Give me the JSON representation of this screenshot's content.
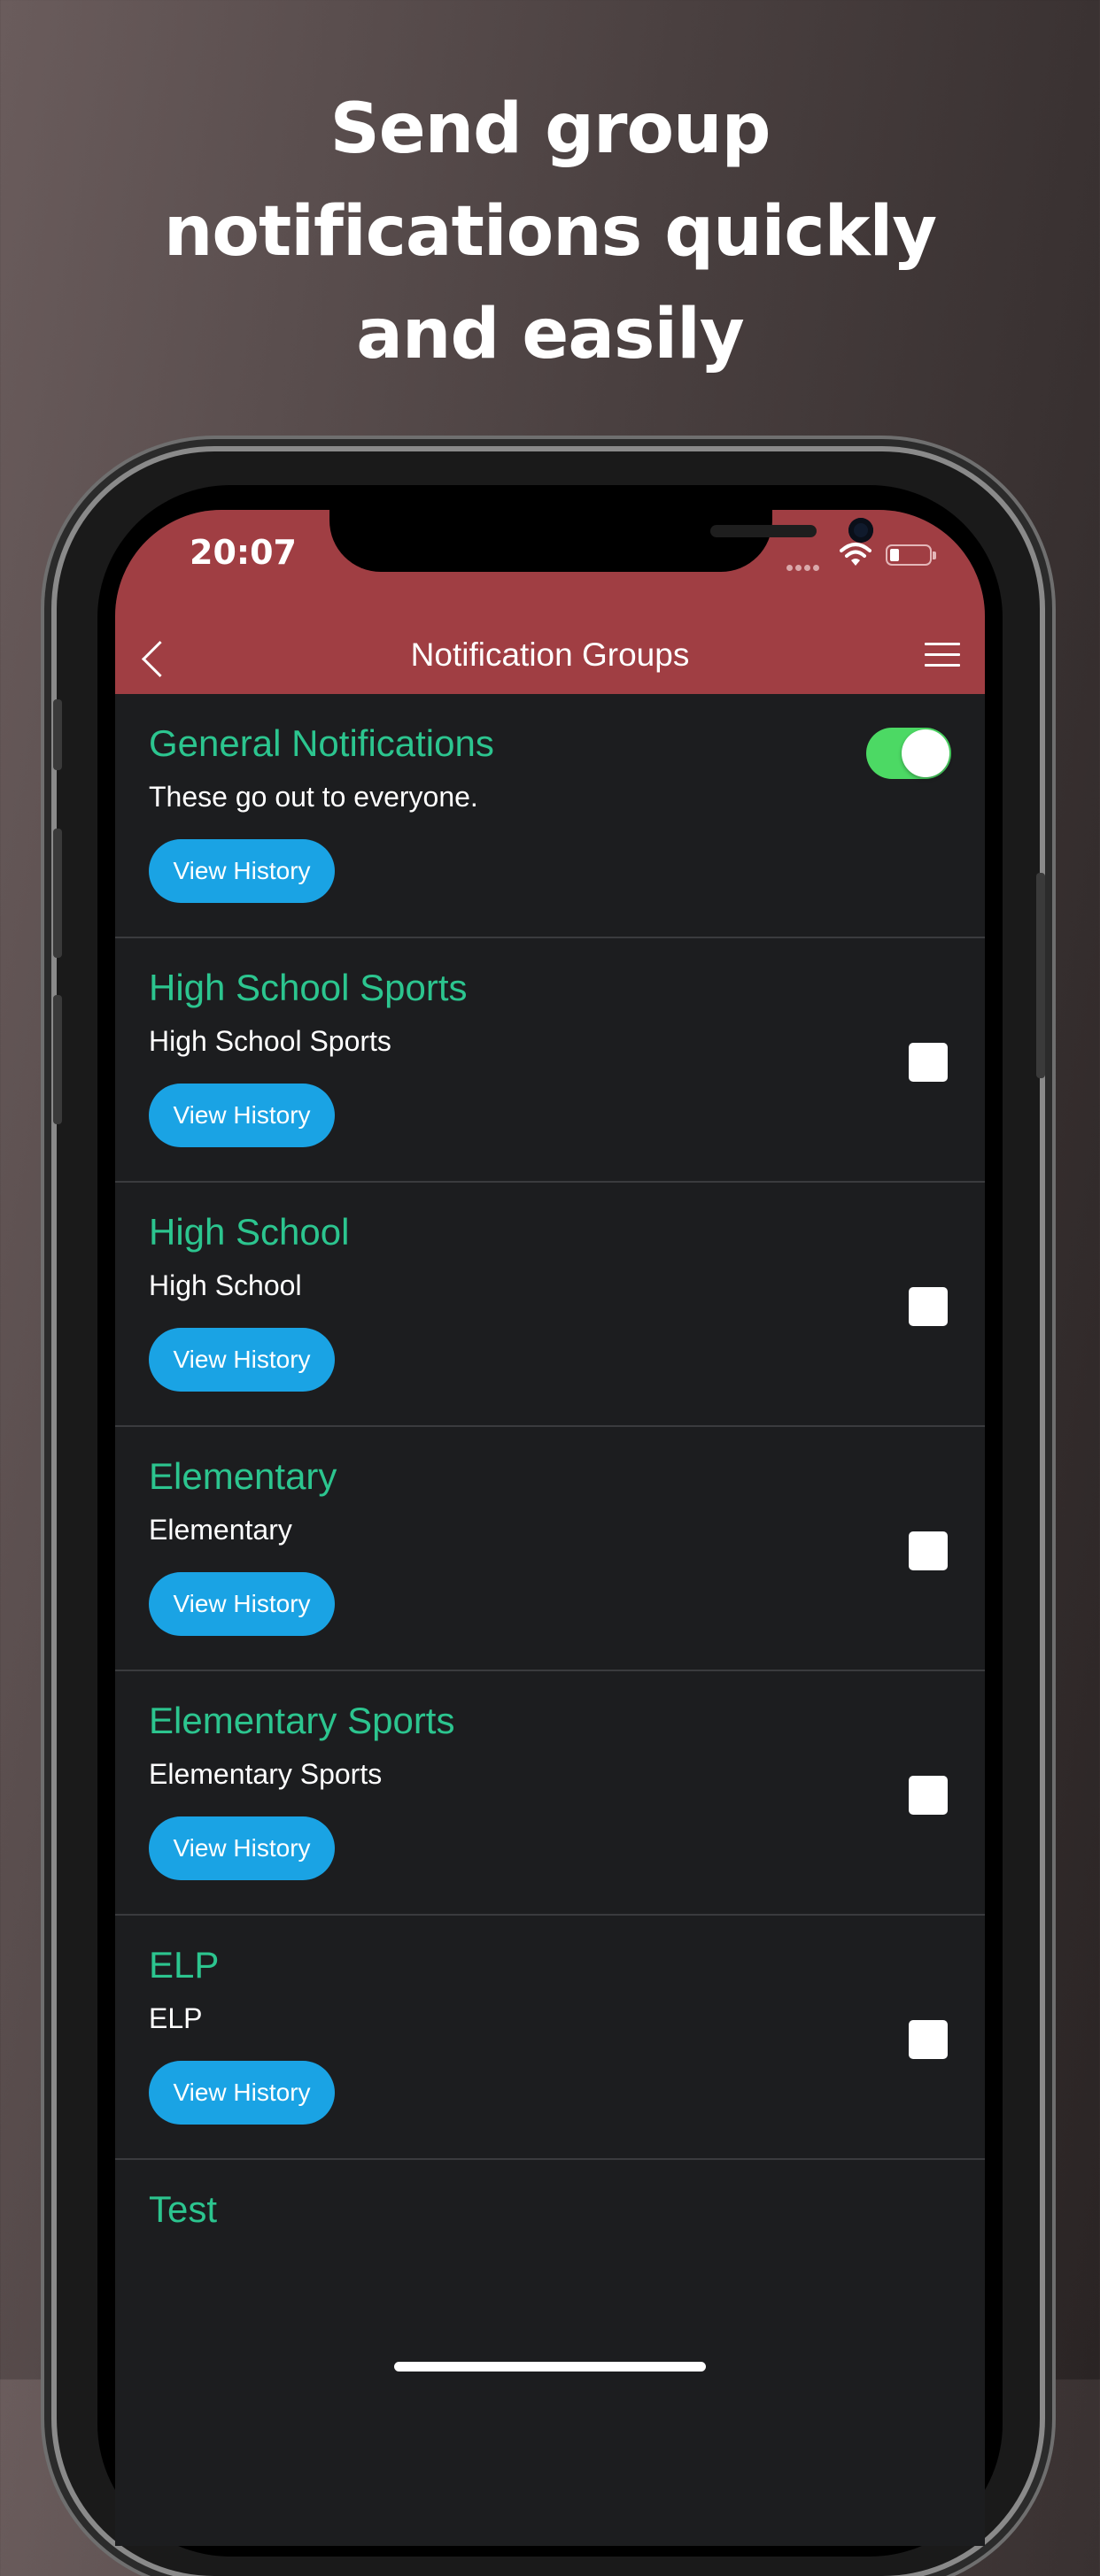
{
  "headline": [
    "Send group",
    "notifications quickly",
    "and easily"
  ],
  "status_bar": {
    "time": "20:07"
  },
  "nav": {
    "title": "Notification Groups"
  },
  "groups": [
    {
      "title": "General Notifications",
      "description": "These go out to everyone.",
      "button": "View History",
      "control": "toggle",
      "enabled": true
    },
    {
      "title": "High School Sports",
      "description": "High School Sports",
      "button": "View History",
      "control": "checkbox",
      "checked": false
    },
    {
      "title": "High School",
      "description": "High School",
      "button": "View History",
      "control": "checkbox",
      "checked": false
    },
    {
      "title": "Elementary",
      "description": "Elementary",
      "button": "View History",
      "control": "checkbox",
      "checked": false
    },
    {
      "title": "Elementary Sports",
      "description": "Elementary Sports",
      "button": "View History",
      "control": "checkbox",
      "checked": false
    },
    {
      "title": "ELP",
      "description": "ELP",
      "button": "View History",
      "control": "checkbox",
      "checked": false
    },
    {
      "title": "Test"
    }
  ],
  "colors": {
    "header": "#a03e43",
    "group_title": "#2cc58f",
    "button": "#1aa3e4",
    "toggle_on": "#4cd964",
    "list_background": "#1c1d1f"
  },
  "icons": {
    "back": "chevron-left-icon",
    "menu": "hamburger-menu-icon",
    "wifi": "wifi-icon",
    "battery": "battery-icon",
    "signal": "cellular-signal-icon"
  }
}
